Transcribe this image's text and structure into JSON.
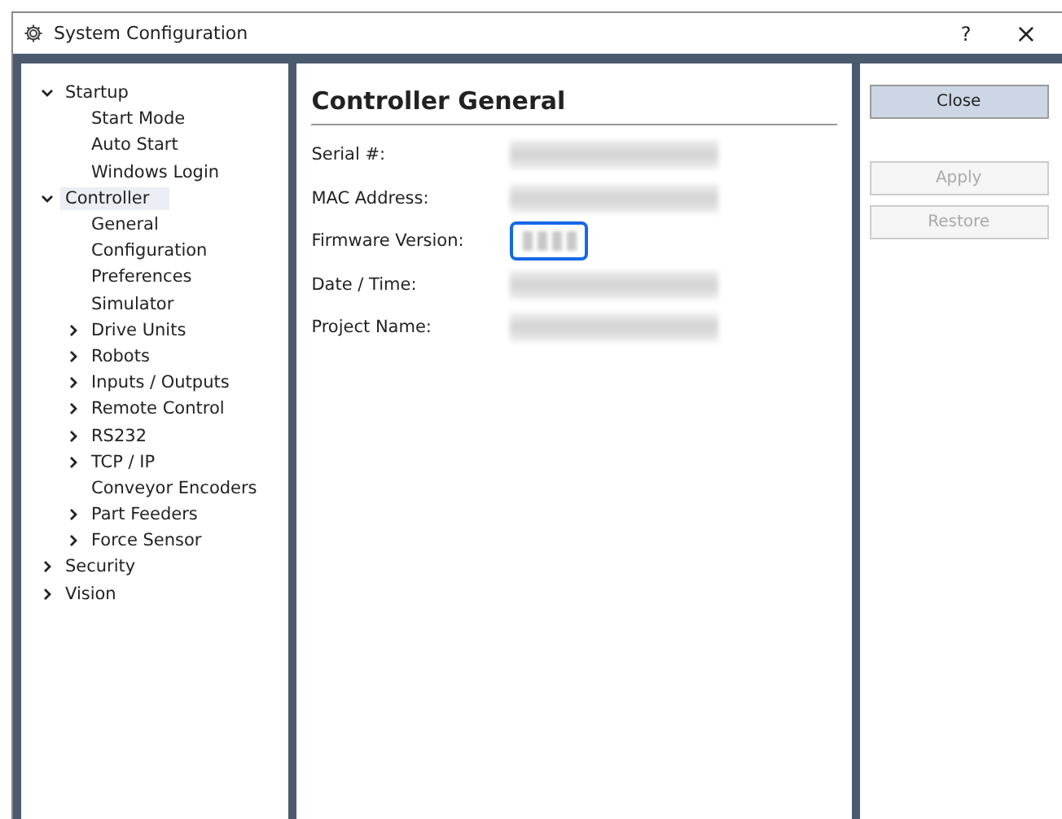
{
  "window": {
    "title": "System Configuration",
    "help": "?",
    "close": "×"
  },
  "tree": [
    {
      "label": "Startup",
      "expanded": true,
      "selected": false,
      "children": [
        {
          "label": "Start Mode",
          "selected": false
        },
        {
          "label": "Auto Start",
          "selected": false
        },
        {
          "label": "Windows Login",
          "selected": false
        }
      ]
    },
    {
      "label": "Controller",
      "expanded": true,
      "selected": true,
      "children": [
        {
          "label": "General",
          "selected": false
        },
        {
          "label": "Configuration",
          "selected": false
        },
        {
          "label": "Preferences",
          "selected": false
        },
        {
          "label": "Simulator",
          "selected": false
        },
        {
          "label": "Drive Units",
          "expanded": false,
          "selected": false
        },
        {
          "label": "Robots",
          "expanded": false,
          "selected": false
        },
        {
          "label": "Inputs / Outputs",
          "expanded": false,
          "selected": false
        },
        {
          "label": "Remote Control",
          "expanded": false,
          "selected": false
        },
        {
          "label": "RS232",
          "expanded": false,
          "selected": false
        },
        {
          "label": "TCP / IP",
          "expanded": false,
          "selected": false
        },
        {
          "label": "Conveyor Encoders",
          "selected": false
        },
        {
          "label": "Part Feeders",
          "expanded": false,
          "selected": false
        },
        {
          "label": "Force Sensor",
          "expanded": false,
          "selected": false
        }
      ]
    },
    {
      "label": "Security",
      "expanded": false,
      "selected": false
    },
    {
      "label": "Vision",
      "expanded": false,
      "selected": false
    }
  ],
  "panel": {
    "title": "Controller General",
    "fields": [
      {
        "label": "Serial #:",
        "highlighted": false
      },
      {
        "label": "MAC Address:",
        "highlighted": false
      },
      {
        "label": "Firmware Version:",
        "highlighted": true
      },
      {
        "label": "Date / Time:",
        "highlighted": false
      },
      {
        "label": "Project Name:",
        "highlighted": false
      }
    ]
  },
  "buttons": [
    {
      "label": "Close",
      "disabled": false
    },
    {
      "label": "Apply",
      "disabled": true
    },
    {
      "label": "Restore",
      "disabled": true
    }
  ]
}
